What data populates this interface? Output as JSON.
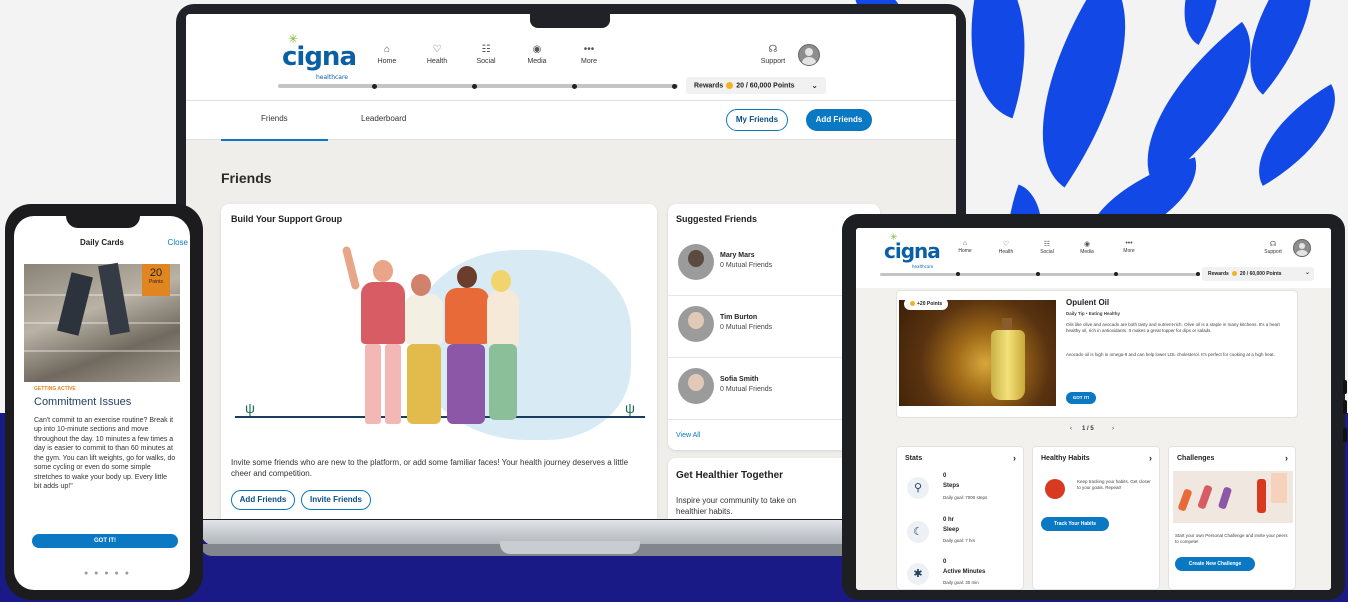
{
  "brand": {
    "logo": "cigna",
    "tagline": "healthcare",
    "accent": "#0b78c3",
    "navy": "#1a1a86",
    "leaf_blue": "#1248e6"
  },
  "nav": {
    "items": [
      {
        "label": "Home",
        "icon": "home-icon"
      },
      {
        "label": "Health",
        "icon": "heart-icon"
      },
      {
        "label": "Social",
        "icon": "people-icon"
      },
      {
        "label": "Media",
        "icon": "play-icon"
      },
      {
        "label": "More",
        "icon": "more-icon"
      }
    ],
    "support": "Support",
    "rewards_label": "Rewards",
    "rewards_points": "20 / 60,000 Points"
  },
  "laptop": {
    "tabs": [
      "Friends",
      "Leaderboard"
    ],
    "my_friends_button": "My Friends",
    "add_friends_button": "Add Friends",
    "page_title": "Friends",
    "support_card": {
      "title": "Build Your Support Group",
      "description": "Invite some friends who are new to the platform, or add some familiar faces! Your health journey deserves a little cheer and competition.",
      "add_button": "Add Friends",
      "invite_button": "Invite Friends"
    },
    "suggested": {
      "title": "Suggested Friends",
      "friends": [
        {
          "name": "Mary Mars",
          "mutual": "0 Mutual Friends"
        },
        {
          "name": "Tim Burton",
          "mutual": "0 Mutual Friends"
        },
        {
          "name": "Sofia Smith",
          "mutual": "0 Mutual Friends"
        }
      ],
      "view_all": "View All"
    },
    "together": {
      "title": "Get Healthier Together",
      "description": "Inspire your community to take on healthier habits."
    }
  },
  "phone": {
    "header": "Daily Cards",
    "close": "Close",
    "badge_value": "20",
    "badge_label": "Points",
    "category": "GETTING ACTIVE",
    "title": "Commitment Issues",
    "body": "Can't commit to an exercise routine? Break it up into 10-minute sections and move throughout the day. 10 minutes a few times a day is easier to commit to than 60 minutes at the gym. You can lift weights, go for walks, do some cycling or even do some simple stretches to wake your body up. Every little bit adds up!\"",
    "button": "GOT IT!",
    "pager": "● ● ● ● ●"
  },
  "tablet": {
    "daily_card": {
      "points_chip": "+20 Points",
      "title": "Opulent Oil",
      "subtitle": "Daily Tip • Eating Healthy",
      "p1": "Oils like olive and avocado are both tasty and nutrient-rich. Olive oil is a staple in many kitchens. It's a heart healthy oil, rich in antioxidants. It makes a great topper for dips or salads.",
      "p2": "Avocado oil is high in omega-9 and can help lower LDL cholesterol. It's perfect for cooking at a high heat.",
      "button": "GOT IT!",
      "pager": "1 / 5",
      "prev": "‹",
      "next": "›"
    },
    "stats": {
      "title": "Stats",
      "chevron": "›",
      "items": [
        {
          "value": "0",
          "label": "Steps",
          "goal": "Daily goal: 7000 steps"
        },
        {
          "value": "0 hr",
          "label": "Sleep",
          "goal": "Daily goal: 7 hrs"
        },
        {
          "value": "0",
          "label": "Active Minutes",
          "goal": "Daily goal: 30 min"
        }
      ]
    },
    "habits": {
      "title": "Healthy Habits",
      "chevron": "›",
      "text": "Keep tracking your habits. Get closer to your goals. Repeat!",
      "button": "Track Your Habits"
    },
    "challenges": {
      "title": "Challenges",
      "chevron": "›",
      "text": "Start your own Personal Challenge and invite your peers to compete!",
      "button": "Create New Challenge"
    }
  }
}
